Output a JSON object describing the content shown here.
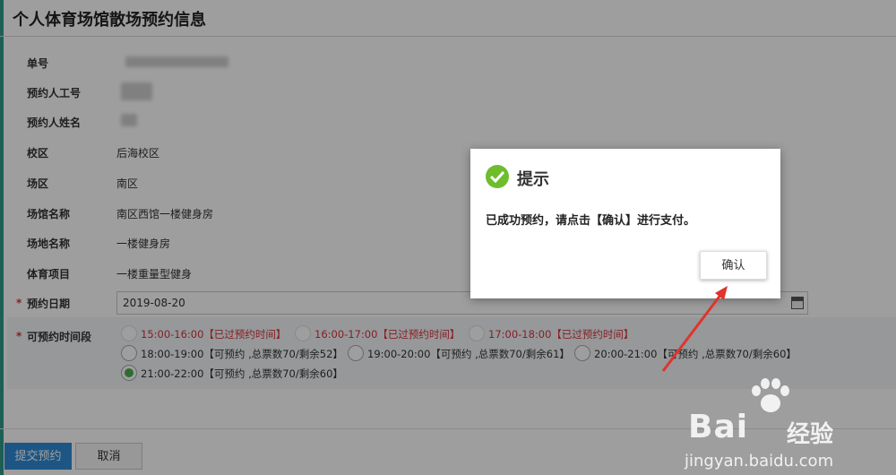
{
  "page": {
    "title": "个人体育场馆散场预约信息"
  },
  "form": {
    "rows": [
      {
        "label": "单号",
        "value": ""
      },
      {
        "label": "预约人工号",
        "value": ""
      },
      {
        "label": "预约人姓名",
        "value": ""
      },
      {
        "label": "校区",
        "value": "后海校区"
      },
      {
        "label": "场区",
        "value": "南区"
      },
      {
        "label": "场馆名称",
        "value": "南区西馆一楼健身房"
      },
      {
        "label": "场地名称",
        "value": "一楼健身房"
      },
      {
        "label": "体育项目",
        "value": "一楼重量型健身"
      }
    ],
    "date_label": "预约日期",
    "date_value": "2019-08-20",
    "slot_label": "可预约时间段",
    "required_mark": "*",
    "slots": [
      {
        "text": "15:00-16:00【已过预约时间】",
        "state": "past"
      },
      {
        "text": "16:00-17:00【已过预约时间】",
        "state": "past"
      },
      {
        "text": "17:00-18:00【已过预约时间】",
        "state": "past"
      },
      {
        "text": "18:00-19:00【可预约 ,总票数70/剩余52】",
        "state": "open"
      },
      {
        "text": "19:00-20:00【可预约 ,总票数70/剩余61】",
        "state": "open"
      },
      {
        "text": "20:00-21:00【可预约 ,总票数70/剩余60】",
        "state": "open"
      },
      {
        "text": "21:00-22:00【可预约 ,总票数70/剩余60】",
        "state": "selected"
      }
    ]
  },
  "actions": {
    "submit_label": "提交预约",
    "cancel_label": "取消"
  },
  "dialog": {
    "title": "提示",
    "message": "已成功预约，请点击【确认】进行支付。",
    "ok_label": "确认"
  },
  "watermark": {
    "brand": "Bai",
    "brand_tail": "经验",
    "url": "jingyan.baidu.com"
  },
  "colors": {
    "accent": "#2f8bd6",
    "success": "#6dbd2c",
    "past": "#d9333b",
    "arrow": "#e0342c"
  }
}
